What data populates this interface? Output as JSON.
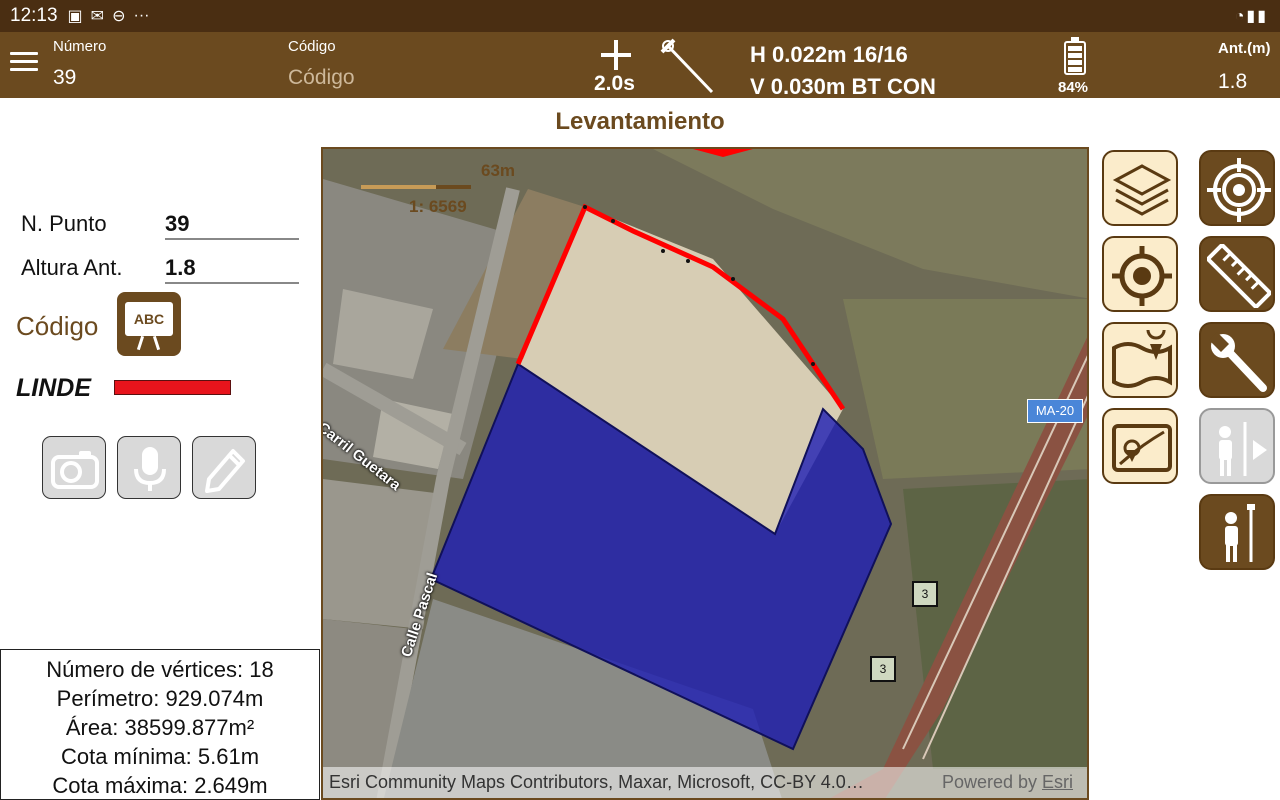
{
  "statusbar": {
    "time": "12:13",
    "dots": "···"
  },
  "appbar": {
    "numero_label": "Número",
    "numero_value": "39",
    "codigo_label": "Código",
    "codigo_placeholder": "Código",
    "interval": "2.0s",
    "h_line": "H 0.022m  16/16",
    "v_line": "V 0.030m  BT CON",
    "battery_pct": "84%",
    "battery_level": 0.84,
    "ant_label": "Ant.(m)",
    "ant_value": "1.8"
  },
  "title": "Levantamiento",
  "panel": {
    "npunto_label": "N. Punto",
    "npunto_value": "39",
    "altura_label": "Altura Ant.",
    "altura_value": "1.8",
    "codigo_label": "Código",
    "abc_text": "ABC",
    "linde_label": "LINDE",
    "linde_color": "#e8141c"
  },
  "stats": {
    "vertices": "Número de vértices: 18",
    "perimetro": "Perímetro: 929.074m",
    "area": "Área: 38599.877m²",
    "cota_min": "Cota mínima: 5.61m",
    "cota_max": "Cota máxima: 2.649m"
  },
  "map": {
    "scale_distance": "63m",
    "scale_ratio": "1: 6569",
    "street_1": "Carril Guetara",
    "street_2": "Calle Pascal",
    "road_badge": "MA-20",
    "exit_1": "3",
    "exit_2": "3",
    "attribution": "Esri Community Maps Contributors, Maxar, Microsoft, CC-BY 4.0…",
    "powered_by": "Powered by ",
    "esri_link": "Esri",
    "polygon_fill": "#1e1eb4",
    "boundary_color": "#ff0000"
  },
  "colors": {
    "brand_dark": "#4a2e12",
    "brand": "#6b4a1f",
    "button_light": "#fbeccb"
  },
  "icons": {
    "layers": "layers-icon",
    "locate": "locate-icon",
    "target": "target-icon",
    "ruler": "ruler-icon",
    "map": "map-pin-icon",
    "wrench": "wrench-icon",
    "gps_map": "gps-map-icon",
    "surveyor_play": "surveyor-play-icon",
    "surveyor": "surveyor-icon",
    "camera": "camera-icon",
    "microphone": "microphone-icon",
    "pencil": "pencil-icon"
  }
}
